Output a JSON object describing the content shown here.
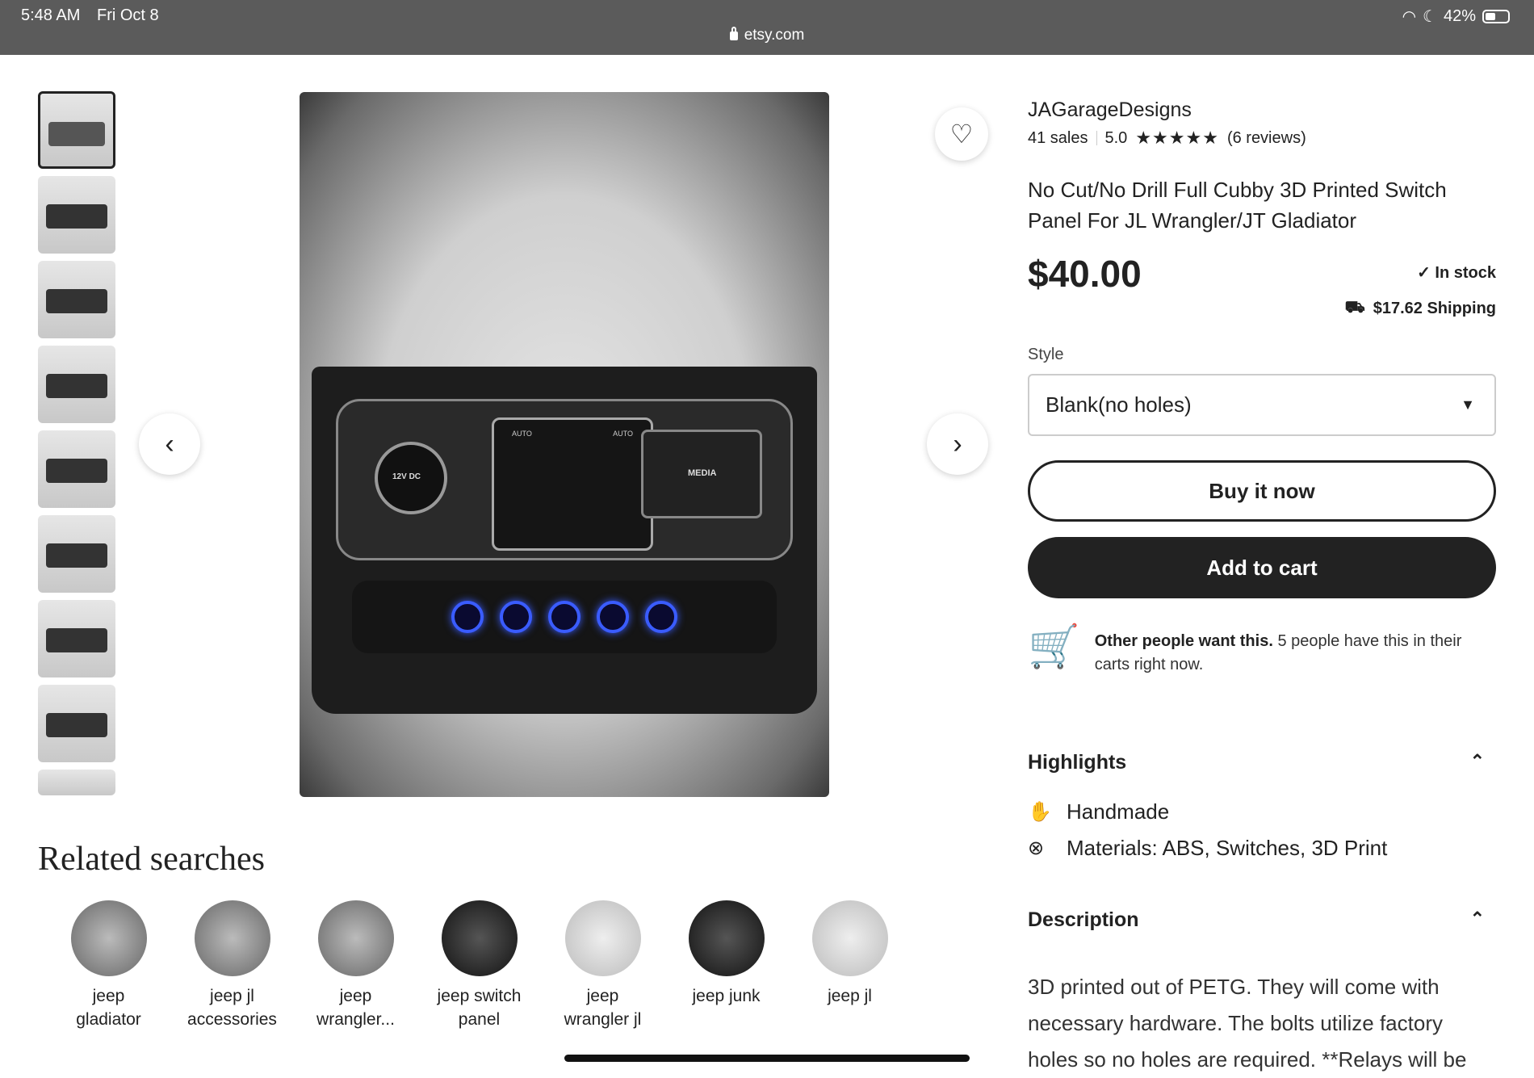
{
  "status_bar": {
    "time": "5:48 AM",
    "date": "Fri Oct 8",
    "url": "etsy.com",
    "battery": "42%"
  },
  "shop": {
    "name": "JAGarageDesigns",
    "sales": "41 sales",
    "rating": "5.0",
    "stars": "★★★★★",
    "reviews": "(6 reviews)"
  },
  "listing": {
    "title": "No Cut/No Drill Full Cubby 3D Printed Switch Panel For JL Wrangler/JT Gladiator",
    "price": "$40.00",
    "stock": "In stock",
    "shipping": "$17.62 Shipping"
  },
  "image_labels": {
    "outlet": "12V DC",
    "media": "MEDIA",
    "auto_left": "AUTO",
    "auto_right": "AUTO"
  },
  "style": {
    "label": "Style",
    "selected": "Blank(no holes)"
  },
  "buttons": {
    "buy_now": "Buy it now",
    "add_to_cart": "Add to cart"
  },
  "promo": {
    "bold": "Other people want this.",
    "text": "5 people have this in their carts right now."
  },
  "highlights": {
    "title": "Highlights",
    "items": [
      {
        "label": "Handmade",
        "icon": "hand-icon"
      },
      {
        "label": "Materials: ABS, Switches, 3D Print",
        "icon": "materials-icon"
      }
    ]
  },
  "description": {
    "title": "Description",
    "text": "3D printed out of PETG. They will come with necessary hardware. The bolts utilize factory holes so no holes are required. **Relays will be"
  },
  "related": {
    "title": "Related searches",
    "items": [
      {
        "line1": "jeep",
        "line2": "gladiator"
      },
      {
        "line1": "jeep jl",
        "line2": "accessories"
      },
      {
        "line1": "jeep",
        "line2": "wrangler..."
      },
      {
        "line1": "jeep switch",
        "line2": "panel"
      },
      {
        "line1": "jeep",
        "line2": "wrangler jl"
      },
      {
        "line1": "jeep junk",
        "line2": ""
      },
      {
        "line1": "jeep jl",
        "line2": ""
      }
    ]
  },
  "colors": {
    "status_bar": "#5b5b5b",
    "primary_button": "#222222",
    "led_blue": "#3a5cff"
  }
}
